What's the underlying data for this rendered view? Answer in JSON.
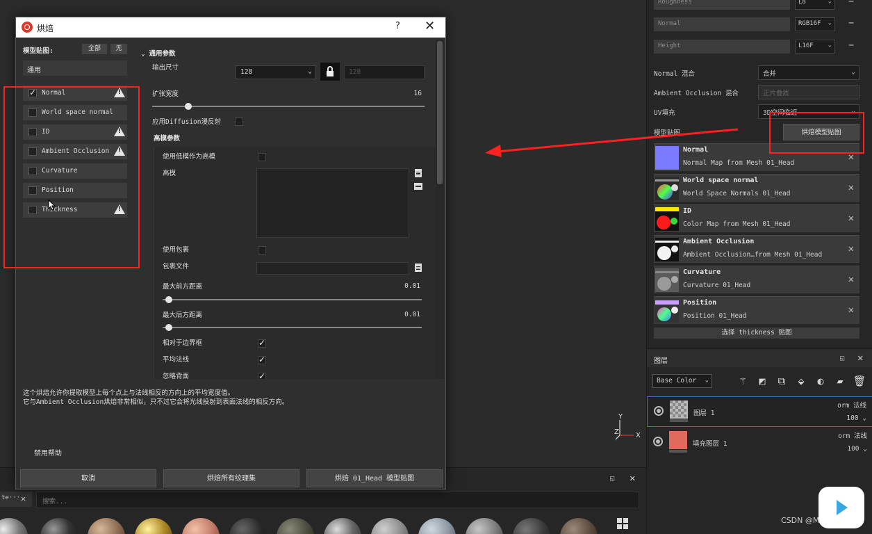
{
  "dialog": {
    "title": "烘焙",
    "help": "?",
    "close": "✕",
    "maps_label": "模型贴图:",
    "btn_all": "全部",
    "btn_none": "无",
    "preset": "通用",
    "maps": [
      {
        "label": "Normal",
        "checked": true,
        "warning": true
      },
      {
        "label": "World space normal",
        "checked": false,
        "warning": false
      },
      {
        "label": "ID",
        "checked": false,
        "warning": true
      },
      {
        "label": "Ambient Occlusion",
        "checked": false,
        "warning": true
      },
      {
        "label": "Curvature",
        "checked": false,
        "warning": false
      },
      {
        "label": "Position",
        "checked": false,
        "warning": false
      },
      {
        "label": "Thickness",
        "checked": false,
        "warning": true
      }
    ],
    "params": {
      "section_common": "通用参数",
      "output_size_label": "输出尺寸",
      "output_size_value": "128",
      "output_size_linked": "128",
      "dilation_label": "扩张宽度",
      "dilation_value": "16",
      "dilation_fraction": 0.12,
      "diffusion_label": "应用Diffusion漫反射",
      "hp_section": "高模参数",
      "use_lp_as_hp": "使用低模作为高模",
      "hp_label": "高模",
      "use_cage": "使用包裹",
      "cage_file": "包裹文件",
      "max_front": "最大前方距离",
      "max_front_value": "0.01",
      "max_front_fraction": 0.01,
      "max_rear": "最大后方距离",
      "max_rear_value": "0.01",
      "max_rear_fraction": 0.01,
      "relative_bbox": "相对于边界框",
      "relative_bbox_checked": true,
      "avg_normals": "平均法线",
      "avg_normals_checked": true,
      "ignore_backface": "忽略背面",
      "ignore_backface_checked": true
    },
    "description_line1": "这个烘焙允许你提取模型上每个点上与法线相反的方向上的平均宽度值。",
    "description_line2": "它与Ambient Occlusion烘焙非常相似，只不过它会将光线投射到表面法线的相反方向。",
    "disable_help": "禁用帮助",
    "btn_cancel": "取消",
    "btn_bake_all": "烘焙所有纹理集",
    "btn_bake_one": "烘焙 01_Head 模型贴图"
  },
  "right_panel": {
    "channels": [
      {
        "name": "Roughness",
        "format": "L8"
      },
      {
        "name": "Normal",
        "format": "RGB16F"
      },
      {
        "name": "Height",
        "format": "L16F"
      }
    ],
    "normal_mix_label": "Normal 混合",
    "normal_mix_value": "合并",
    "ao_mix_label": "Ambient Occlusion 混合",
    "ao_mix_value": "正片叠底",
    "uv_fill_label": "UV填充",
    "uv_fill_value": "3D空间临近",
    "mesh_maps_label": "模型贴图",
    "bake_maps_button": "烘焙模型贴图",
    "mesh_maps": [
      {
        "title": "Normal",
        "subtitle": "Normal Map from Mesh 01_Head",
        "thumb": "normal"
      },
      {
        "title": "World space normal",
        "subtitle": "World Space Normals 01_Head",
        "thumb": "world"
      },
      {
        "title": "ID",
        "subtitle": "Color Map from Mesh 01_Head",
        "thumb": "id"
      },
      {
        "title": "Ambient Occlusion",
        "subtitle": "Ambient Occlusion…from Mesh 01_Head",
        "thumb": "ao"
      },
      {
        "title": "Curvature",
        "subtitle": "Curvature 01_Head",
        "thumb": "curv"
      },
      {
        "title": "Position",
        "subtitle": "Position 01_Head",
        "thumb": "pos"
      }
    ],
    "select_thickness": "选择 thickness 贴图"
  },
  "layers": {
    "title": "图层",
    "channel": "Base Color",
    "items": [
      {
        "name": "图层 1",
        "blend": "orm 法线",
        "opacity": "100",
        "thumb": "checker"
      },
      {
        "name": "填充图层 1",
        "blend": "orm 法线",
        "opacity": "100",
        "thumb": "fill"
      }
    ]
  },
  "shelf": {
    "tab": "te···",
    "search_placeholder": "搜索..."
  },
  "gizmo": {
    "y": "Y",
    "z": "Z",
    "x": "X"
  },
  "watermark": "CSDN @Mumengg-",
  "colors": {
    "annotation_red": "#ff2020",
    "normal_thumb": "#7b7bff",
    "fill_layer_thumb": "#e06a5c"
  }
}
